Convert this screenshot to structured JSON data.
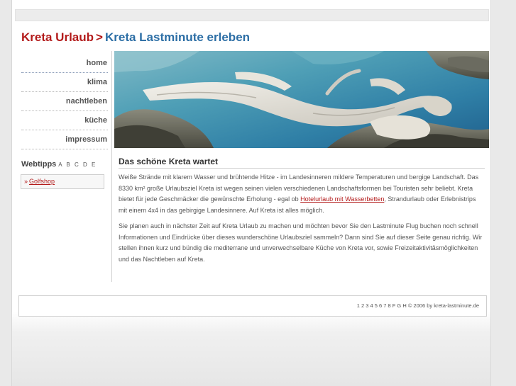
{
  "header": {
    "title_part1": "Kreta Urlaub",
    "separator": ">",
    "title_part2": "Kreta Lastminute erleben"
  },
  "nav": {
    "items": [
      {
        "label": "home"
      },
      {
        "label": "klima"
      },
      {
        "label": "nachtleben"
      },
      {
        "label": "küche"
      },
      {
        "label": "impressum"
      }
    ]
  },
  "webtipps": {
    "title": "Webtipps",
    "letters": "A B C D E",
    "bullet": "»",
    "link": "Golfshop"
  },
  "hero": {
    "icon": "driftwood-beach-photo"
  },
  "content": {
    "heading": "Das schöne Kreta wartet",
    "p1_text1": "Weiße Strände mit klarem Wasser und brühtende Hitze - im Landesinneren mildere Temperaturen und bergige Landschaft. Das 8330 km² große Urlaubsziel Kreta ist wegen seinen vielen verschiedenen Landschaftsformen bei Touristen sehr beliebt. Kreta bietet für jede Geschmäcker die gewünschte Erholung - egal ob ",
    "p1_link": "Hotelurlaub mit Wasserbetten",
    "p1_text2": ", Strandurlaub oder Erlebnistrips mit einem 4x4 in das gebirgige Landesinnere. Auf Kreta ist alles möglich.",
    "p2": "Sie planen auch in nächster Zeit auf Kreta Urlaub zu machen und möchten bevor Sie den Lastminute Flug buchen noch schnell Informationen und Eindrücke über dieses wunderschöne Urlaubsziel sammeln? Dann sind Sie auf dieser Seite genau richtig. Wir stellen ihnen kurz und bündig die mediterrane und unverwechselbare Küche von Kreta vor, sowie Freizeitaktivitäsmöglichkeiten und das Nachtleben auf Kreta."
  },
  "footer": {
    "text": "1 2 3 4 5 6 7 8 F G H © 2006 by kreta-lastminute.de"
  },
  "colors": {
    "brand_red": "#b31b1b",
    "brand_blue": "#2c6ea5"
  }
}
